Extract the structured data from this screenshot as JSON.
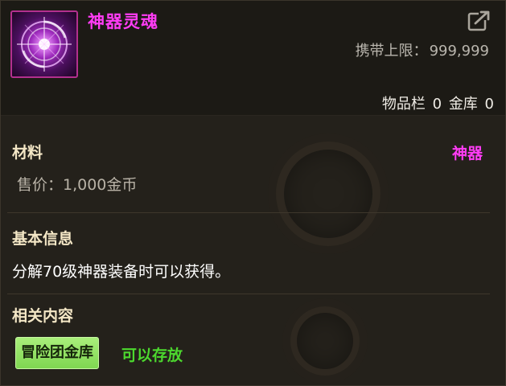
{
  "item": {
    "name": "神器灵魂",
    "icon": "artifact-soul-orb-icon",
    "rarity_color": "#ff3cf5"
  },
  "header": {
    "carry_limit_label": "携带上限：",
    "carry_limit_value": "999,999",
    "inventory_label": "物品栏",
    "inventory_count": "0",
    "vault_label": "金库",
    "vault_count": "0",
    "export_icon": "export-icon"
  },
  "material_section": {
    "title": "材料",
    "type_label": "神器",
    "sell_price": "售价：1,000金币"
  },
  "info_section": {
    "title": "基本信息",
    "description": "分解70级神器装备时可以获得。"
  },
  "related_section": {
    "title": "相关内容",
    "tag_label": "冒险团金库",
    "tag_color": "#8fe25f",
    "status_text": "可以存放",
    "status_color": "#4cd82e"
  }
}
